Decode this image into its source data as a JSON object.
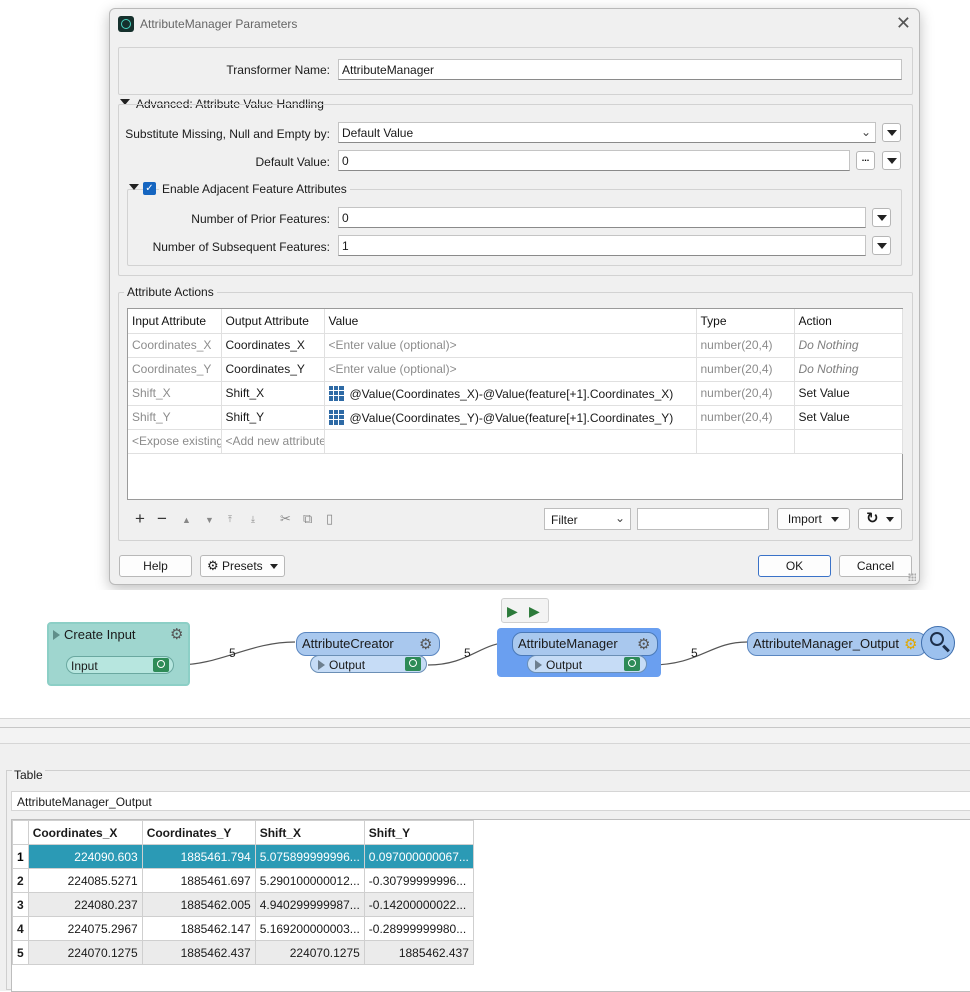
{
  "dialog": {
    "title": "AttributeManager Parameters",
    "transformer_name_label": "Transformer Name:",
    "transformer_name_value": "AttributeManager",
    "advanced_title": "Advanced: Attribute Value Handling",
    "substitute_label": "Substitute Missing, Null and Empty by:",
    "substitute_value": "Default Value",
    "default_value_label": "Default Value:",
    "default_value": "0",
    "ellipsis": "...",
    "adjacent_title": "Enable Adjacent Feature Attributes",
    "prior_label": "Number of Prior Features:",
    "prior_value": "0",
    "subsequent_label": "Number of Subsequent Features:",
    "subsequent_value": "1",
    "actions_title": "Attribute Actions",
    "columns": [
      "Input Attribute",
      "Output Attribute",
      "Value",
      "Type",
      "Action"
    ],
    "rows": [
      {
        "input": "Coordinates_X",
        "output": "Coordinates_X",
        "value": "<Enter value (optional)>",
        "type": "number(20,4)",
        "action": "Do Nothing"
      },
      {
        "input": "Coordinates_Y",
        "output": "Coordinates_Y",
        "value": "<Enter value (optional)>",
        "type": "number(20,4)",
        "action": "Do Nothing"
      },
      {
        "input": "Shift_X",
        "output": "Shift_X",
        "value": "@Value(Coordinates_X)-@Value(feature[+1].Coordinates_X)",
        "type": "number(20,4)",
        "action": "Set Value"
      },
      {
        "input": "Shift_Y",
        "output": "Shift_Y",
        "value": "@Value(Coordinates_Y)-@Value(feature[+1].Coordinates_Y)",
        "type": "number(20,4)",
        "action": "Set Value"
      }
    ],
    "new_row": {
      "input": "<Expose existing",
      "output": "<Add new attribute"
    },
    "filter_label": "Filter",
    "import_label": "Import",
    "help_label": "Help",
    "presets_label": "Presets",
    "ok_label": "OK",
    "cancel_label": "Cancel"
  },
  "workflow": {
    "create_input": {
      "title": "Create Input",
      "port": "Input"
    },
    "attribute_creator": {
      "title": "AttributeCreator",
      "port": "Output"
    },
    "attribute_manager": {
      "title": "AttributeManager",
      "port": "Output"
    },
    "output_node": {
      "title": "AttributeManager_Output"
    },
    "link_counts": [
      "5",
      "5",
      "5"
    ]
  },
  "table_panel": {
    "title": "Table",
    "dataset_name": "AttributeManager_Output",
    "columns": [
      "Coordinates_X",
      "Coordinates_Y",
      "Shift_X",
      "Shift_Y"
    ],
    "rows": [
      [
        "1",
        "224090.603",
        "1885461.794",
        "5.075899999996...",
        "0.097000000067..."
      ],
      [
        "2",
        "224085.5271",
        "1885461.697",
        "5.290100000012...",
        "-0.30799999996..."
      ],
      [
        "3",
        "224080.237",
        "1885462.005",
        "4.940299999987...",
        "-0.14200000022..."
      ],
      [
        "4",
        "224075.2967",
        "1885462.147",
        "5.169200000003...",
        "-0.28999999980..."
      ],
      [
        "5",
        "224070.1275",
        "1885462.437",
        "224070.1275",
        "1885462.437"
      ]
    ]
  },
  "colors": {
    "selected_row": "#2b9ab5",
    "create_input_node": "#9fd6cf",
    "transformer_node": "#a9c8ee",
    "selected_node": "#6a9ff0"
  }
}
